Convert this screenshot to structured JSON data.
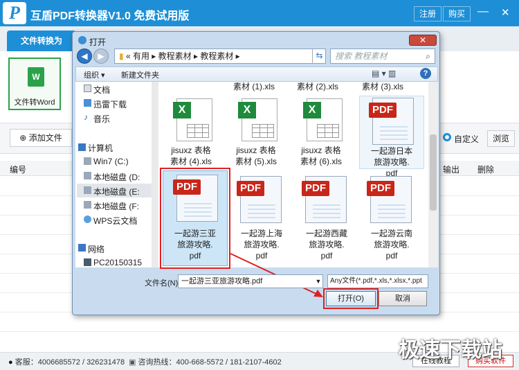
{
  "app": {
    "title": "互盾PDF转换器V1.0 免费试用版",
    "logo_letter": "P",
    "register_label": "注册",
    "buy_label": "购买",
    "minimize_icon": "—",
    "close_icon": "✕"
  },
  "tabs": {
    "active": "文件转换为"
  },
  "panel": {
    "word_icon": "W",
    "word_label": "文件转Word"
  },
  "toolbar": {
    "add_file": "添加文件",
    "custom": "自定义",
    "browse": "浏览"
  },
  "list": {
    "col_no": "编号",
    "col_output": "输出",
    "col_delete": "删除"
  },
  "status": {
    "service": "客服：4006685572 / 326231478",
    "hotline": "咨询热线：400-668-5572 / 181-2107-4602",
    "tutorial": "在线教程",
    "buy": "购买软件"
  },
  "watermark": "极速下载站",
  "dialog": {
    "title": "打开",
    "close_icon": "✕",
    "back_icon": "◀",
    "forward_icon": "▶",
    "address": "«  有用  ▸  教程素材  ▸  教程素材  ▸",
    "refresh_icon": "⇆",
    "search_placeholder": "搜索 教程素材",
    "organize": "组织 ▾",
    "new_folder": "新建文件夹",
    "view_icons": "▤ ▾   ▥",
    "help_icon": "?",
    "tree": [
      {
        "label": "文档"
      },
      {
        "label": "迅雷下载"
      },
      {
        "label": "音乐"
      },
      {
        "label": "计算机"
      },
      {
        "label": "Win7 (C:)"
      },
      {
        "label": "本地磁盘 (D:"
      },
      {
        "label": "本地磁盘 (E:"
      },
      {
        "label": "本地磁盘 (F:"
      },
      {
        "label": "WPS云文档"
      },
      {
        "label": "网络"
      },
      {
        "label": "PC20150315"
      }
    ],
    "files_top": [
      "素材 (1).xls",
      "素材 (2).xls",
      "素材 (3).xls"
    ],
    "files": [
      {
        "name1": "jisuxz 表格",
        "name2": "素材 (4).xls",
        "name3": "",
        "type": "xls",
        "badge": "X"
      },
      {
        "name1": "jisuxz 表格",
        "name2": "素材 (5).xls",
        "name3": "",
        "type": "xls",
        "badge": "X"
      },
      {
        "name1": "jisuxz 表格",
        "name2": "素材 (6).xls",
        "name3": "",
        "type": "xls",
        "badge": "X"
      },
      {
        "name1": "一起游日本",
        "name2": "旅游攻略.",
        "name3": "pdf",
        "type": "pdf",
        "badge": "PDF"
      },
      {
        "name1": "一起游三亚",
        "name2": "旅游攻略.",
        "name3": "pdf",
        "type": "pdf",
        "badge": "PDF"
      },
      {
        "name1": "一起游上海",
        "name2": "旅游攻略.",
        "name3": "pdf",
        "type": "pdf",
        "badge": "PDF"
      },
      {
        "name1": "一起游西藏",
        "name2": "旅游攻略.",
        "name3": "pdf",
        "type": "pdf",
        "badge": "PDF"
      },
      {
        "name1": "一起游云南",
        "name2": "旅游攻略.",
        "name3": "pdf",
        "type": "pdf",
        "badge": "PDF"
      }
    ],
    "filename_label": "文件名(N):",
    "filename_value": "一起游三亚旅游攻略.pdf",
    "filetype": "Any文件(*.pdf,*.xls,*.xlsx,*.ppt",
    "open_button": "打开(O)",
    "cancel_button": "取消"
  }
}
